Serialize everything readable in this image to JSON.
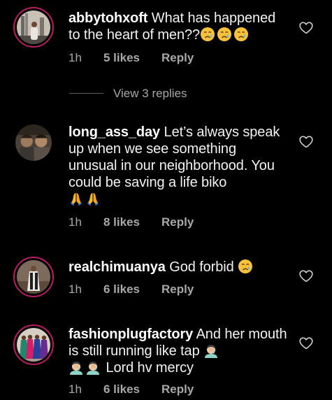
{
  "comments": [
    {
      "username": "abbytohxoft",
      "text": " What has happened to the heart of men??",
      "emojis": [
        "crying-face",
        "crying-face",
        "crying-face"
      ],
      "time": "1h",
      "likes": "5 likes",
      "reply": "Reply"
    },
    {
      "username": "long_ass_day",
      "text": " Let’s always speak up when we see something unusual in our neighborhood. You could be saving a life biko",
      "emojis": [
        "folded-hands",
        "folded-hands"
      ],
      "time": "1h",
      "likes": "8 likes",
      "reply": "Reply"
    },
    {
      "username": "realchimuanya",
      "text": " God forbid ",
      "emojis": [
        "crying-face"
      ],
      "time": "1h",
      "likes": "6 likes",
      "reply": "Reply"
    },
    {
      "username": "fashionplugfactory",
      "text": " And her mouth is still running like tap ",
      "text2": " Lord hv mercy",
      "emojis": [
        "facepalm",
        "facepalm",
        "facepalm"
      ],
      "time": "1h",
      "likes": "6 likes",
      "reply": "Reply"
    }
  ],
  "view_replies": "View 3 replies",
  "colors": {
    "background": "#000000",
    "text": "#f2f2f2",
    "meta": "#a8a8a8",
    "story_ring": "#b51f62"
  }
}
